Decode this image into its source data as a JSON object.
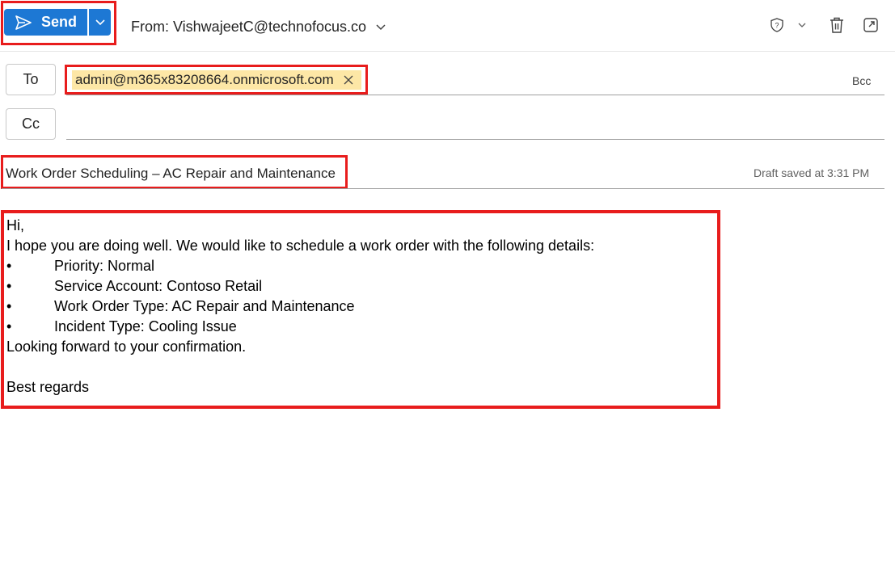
{
  "toolbar": {
    "send_label": "Send",
    "from_label": "From: VishwajeetC@technofocus.co",
    "icons": [
      "send-icon",
      "chevron-down-icon",
      "shield-question-icon",
      "trash-icon",
      "pop-out-icon"
    ]
  },
  "recipients": {
    "to_label": "To",
    "cc_label": "Cc",
    "bcc_label": "Bcc",
    "to_chips": [
      "admin@m365x83208664.onmicrosoft.com"
    ]
  },
  "subject": {
    "value": "Work Order Scheduling – AC Repair and Maintenance",
    "draft_status": "Draft saved at 3:31 PM"
  },
  "message": {
    "greeting": "Hi,",
    "intro": "I hope you are doing well. We would like to schedule a work order with the following details:",
    "bullets": [
      "Priority: Normal",
      "Service Account: Contoso Retail",
      "Work Order Type: AC Repair and Maintenance",
      "Incident Type: Cooling Issue"
    ],
    "bullet_char": "•",
    "closing_line": "Looking forward to your confirmation.",
    "signoff": "Best regards"
  },
  "colors": {
    "accent": "#1d78d4",
    "highlight_border": "#e81c1c",
    "chip_bg": "#fde7a6"
  }
}
